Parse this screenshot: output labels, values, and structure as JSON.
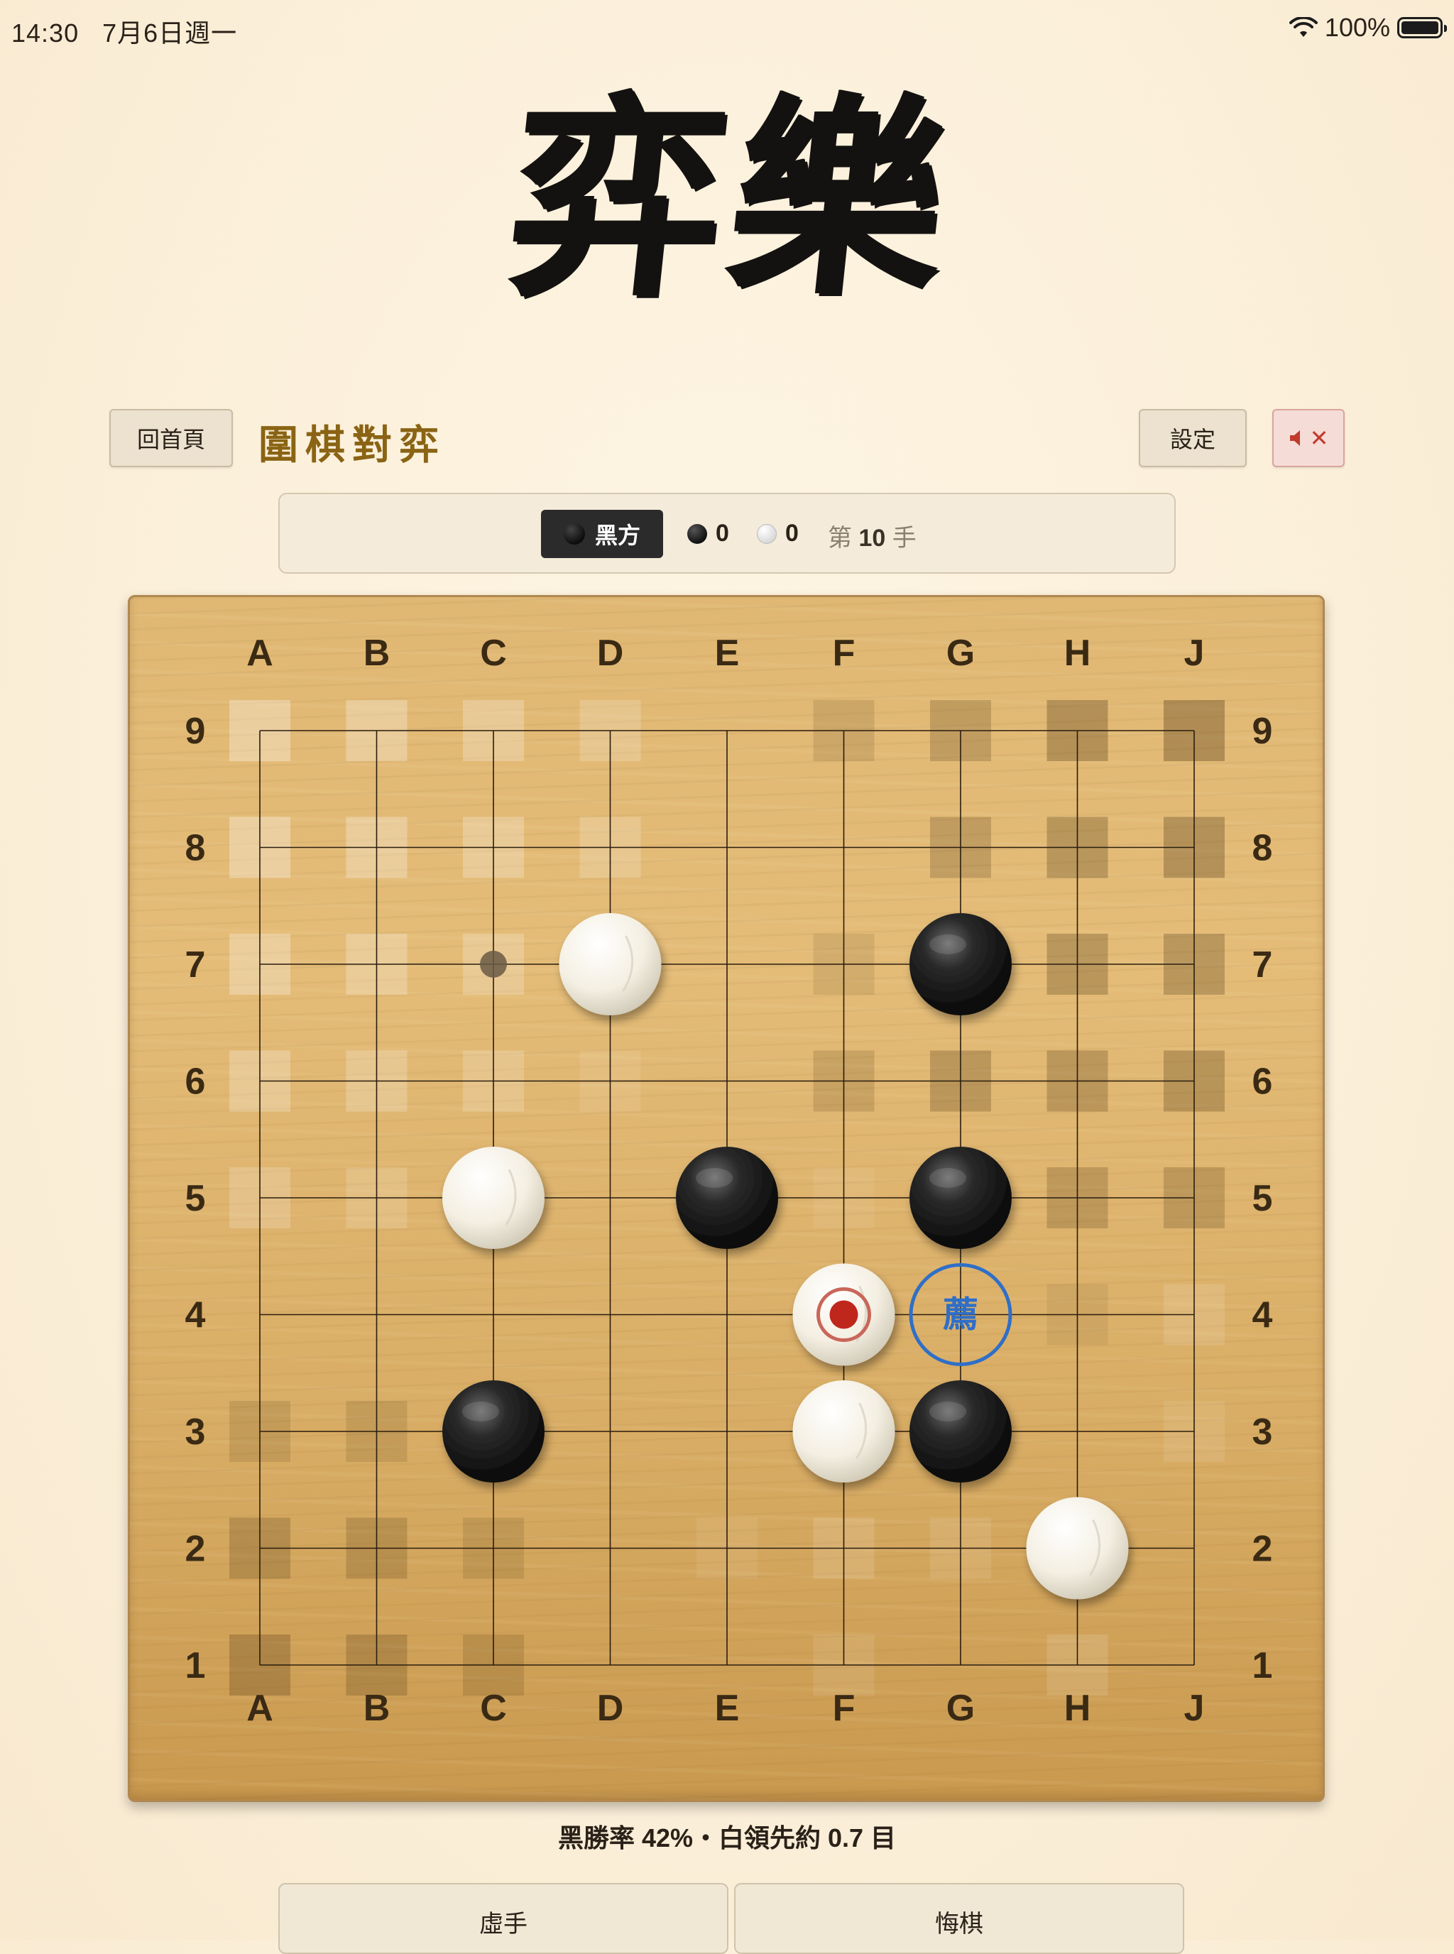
{
  "status": {
    "time": "14:30",
    "date": "7月6日週一",
    "battery": "100%"
  },
  "logo_text": "弈樂",
  "header": {
    "home_label": "回首頁",
    "title": "圍棋對弈",
    "settings_label": "設定",
    "mute_label": "✕"
  },
  "game_info": {
    "turn_label": "黑方",
    "black_captures": "0",
    "white_captures": "0",
    "move_prefix": "第",
    "move_number": "10",
    "move_suffix": "手"
  },
  "board": {
    "columns": [
      "A",
      "B",
      "C",
      "D",
      "E",
      "F",
      "G",
      "H",
      "J"
    ],
    "rows": [
      "9",
      "8",
      "7",
      "6",
      "5",
      "4",
      "3",
      "2",
      "1"
    ],
    "stones": [
      {
        "col": "D",
        "row": 7,
        "color": "white"
      },
      {
        "col": "G",
        "row": 7,
        "color": "black"
      },
      {
        "col": "C",
        "row": 5,
        "color": "white"
      },
      {
        "col": "E",
        "row": 5,
        "color": "black"
      },
      {
        "col": "G",
        "row": 5,
        "color": "black"
      },
      {
        "col": "F",
        "row": 4,
        "color": "white",
        "last_move": true
      },
      {
        "col": "C",
        "row": 3,
        "color": "black"
      },
      {
        "col": "F",
        "row": 3,
        "color": "white"
      },
      {
        "col": "G",
        "row": 3,
        "color": "black"
      },
      {
        "col": "H",
        "row": 2,
        "color": "white"
      }
    ],
    "star_points": [
      {
        "col": "C",
        "row": 7
      }
    ],
    "recommendation": {
      "col": "G",
      "row": 4,
      "label": "薦"
    },
    "territory": {
      "white": [
        [
          "A",
          9,
          0.5
        ],
        [
          "B",
          9,
          0.45
        ],
        [
          "C",
          9,
          0.4
        ],
        [
          "D",
          9,
          0.3
        ],
        [
          "A",
          8,
          0.5
        ],
        [
          "B",
          8,
          0.45
        ],
        [
          "C",
          8,
          0.4
        ],
        [
          "D",
          8,
          0.3
        ],
        [
          "A",
          7,
          0.45
        ],
        [
          "B",
          7,
          0.4
        ],
        [
          "C",
          7,
          0.35
        ],
        [
          "A",
          6,
          0.4
        ],
        [
          "B",
          6,
          0.35
        ],
        [
          "C",
          6,
          0.3
        ],
        [
          "D",
          6,
          0.15
        ],
        [
          "A",
          5,
          0.3
        ],
        [
          "B",
          5,
          0.25
        ],
        [
          "E",
          2,
          0.12
        ],
        [
          "F",
          2,
          0.2
        ],
        [
          "G",
          2,
          0.15
        ],
        [
          "F",
          1,
          0.15
        ],
        [
          "H",
          1,
          0.2
        ],
        [
          "J",
          3,
          0.15
        ],
        [
          "J",
          4,
          0.2
        ],
        [
          "F",
          5,
          0.12
        ]
      ],
      "black": [
        [
          "F",
          9,
          0.25
        ],
        [
          "G",
          9,
          0.4
        ],
        [
          "H",
          9,
          0.55
        ],
        [
          "J",
          9,
          0.6
        ],
        [
          "G",
          8,
          0.4
        ],
        [
          "H",
          8,
          0.5
        ],
        [
          "J",
          8,
          0.55
        ],
        [
          "F",
          7,
          0.2
        ],
        [
          "H",
          7,
          0.5
        ],
        [
          "J",
          7,
          0.5
        ],
        [
          "F",
          6,
          0.3
        ],
        [
          "G",
          6,
          0.45
        ],
        [
          "H",
          6,
          0.45
        ],
        [
          "J",
          6,
          0.5
        ],
        [
          "H",
          5,
          0.4
        ],
        [
          "J",
          5,
          0.4
        ],
        [
          "H",
          4,
          0.15
        ],
        [
          "A",
          3,
          0.25
        ],
        [
          "B",
          3,
          0.25
        ],
        [
          "A",
          2,
          0.4
        ],
        [
          "B",
          2,
          0.35
        ],
        [
          "C",
          2,
          0.25
        ],
        [
          "A",
          1,
          0.45
        ],
        [
          "B",
          1,
          0.4
        ],
        [
          "C",
          1,
          0.3
        ]
      ]
    }
  },
  "winrate_text": "黑勝率 42%・白領先約 0.7 目",
  "actions": {
    "pass_label": "虛手",
    "undo_label": "悔棋"
  }
}
